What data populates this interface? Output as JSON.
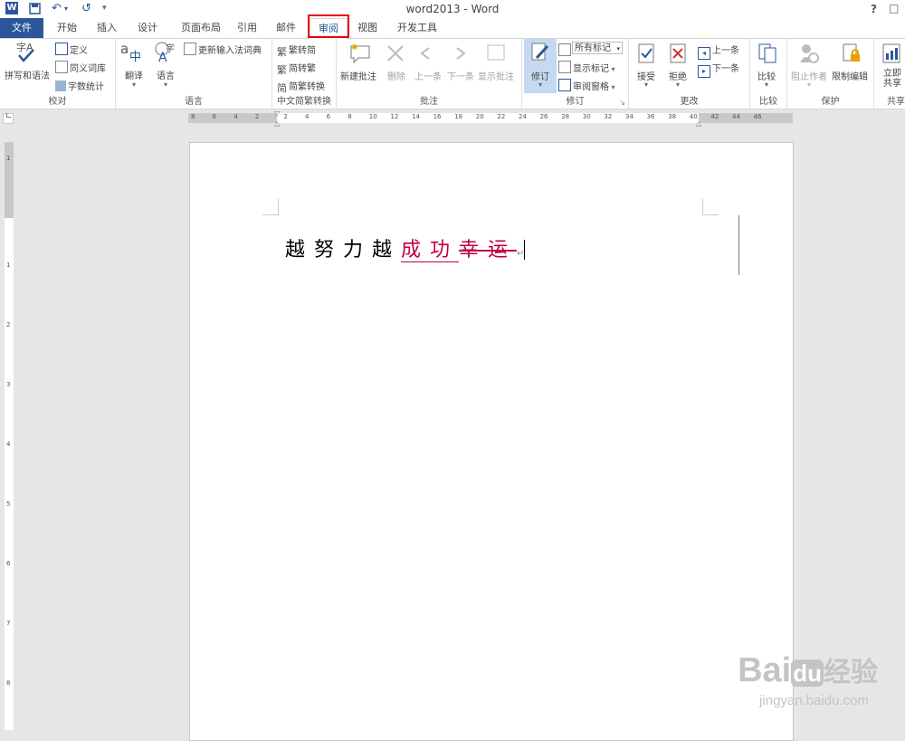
{
  "window": {
    "title": "word2013 - Word",
    "help": "?",
    "restore": "□"
  },
  "quick_access": {
    "word_logo": "W",
    "save_icon": "save-icon",
    "undo": "↶",
    "redo": "↺",
    "customize": "₹"
  },
  "tabs": [
    {
      "label": "文件"
    },
    {
      "label": "开始"
    },
    {
      "label": "插入"
    },
    {
      "label": "设计"
    },
    {
      "label": "页面布局"
    },
    {
      "label": "引用"
    },
    {
      "label": "邮件"
    },
    {
      "label": "审阅"
    },
    {
      "label": "视图"
    },
    {
      "label": "开发工具"
    }
  ],
  "ribbon": {
    "proofing": {
      "label": "校对",
      "spelling": "拼写和语法",
      "define": "定义",
      "thesaurus": "同义词库",
      "word_count": "字数统计"
    },
    "language": {
      "label": "语言",
      "translate": "翻译",
      "language": "语言",
      "update_ime": "更新输入法词典"
    },
    "chinese": {
      "label": "中文简繁转换",
      "t2s": "繁转简",
      "s2t": "简转繁",
      "convert": "简繁转换"
    },
    "comments": {
      "label": "批注",
      "new": "新建批注",
      "delete": "删除",
      "prev": "上一条",
      "next": "下一条",
      "show": "显示批注"
    },
    "tracking": {
      "label": "修订",
      "track": "修订",
      "markup": "所有标记",
      "show_markup": "显示标记",
      "pane": "审阅窗格"
    },
    "changes": {
      "label": "更改",
      "accept": "接受",
      "reject": "拒绝",
      "prev": "上一条",
      "next": "下一条"
    },
    "compare": {
      "label": "比较",
      "compare": "比较"
    },
    "protect": {
      "label": "保护",
      "block": "阻止作者",
      "restrict": "限制编辑"
    },
    "share": {
      "label": "共享",
      "share_now": "立即共享"
    }
  },
  "ruler": {
    "ticks": [
      "8",
      "6",
      "4",
      "2",
      "2",
      "4",
      "6",
      "8",
      "10",
      "12",
      "14",
      "16",
      "18",
      "20",
      "22",
      "24",
      "26",
      "28",
      "30",
      "32",
      "34",
      "36",
      "38",
      "40",
      "42",
      "44",
      "46"
    ],
    "vticks": [
      "1",
      "1",
      "2",
      "3",
      "4",
      "5",
      "6",
      "7",
      "8"
    ]
  },
  "document": {
    "plain": "越努力越",
    "inserted": "成功",
    "deleted": "幸运",
    "mark": "↵"
  },
  "watermark": {
    "main": "Bai",
    "du": "du",
    "jingyan": "经验",
    "url": "jingyan.baidu.com"
  },
  "colors": {
    "accent": "#2b579a",
    "revision": "#c00040",
    "highlight_box": "#e8000b"
  }
}
